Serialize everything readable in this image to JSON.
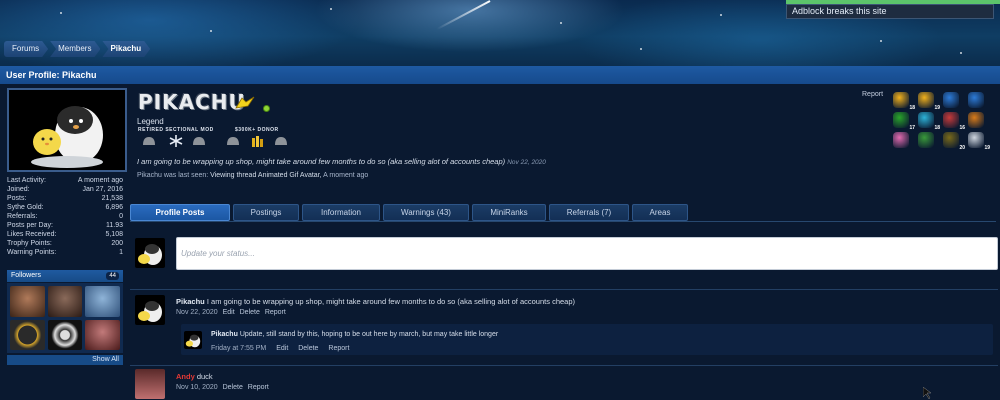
{
  "banner": {
    "adblock_notice": "Adblock breaks this site"
  },
  "breadcrumb": [
    "Forums",
    "Members",
    "Pikachu"
  ],
  "page_title": "User Profile: Pikachu",
  "profile": {
    "username": "PIKACHU",
    "user_title": "Legend",
    "rank_labels": [
      "RETIRED SECTIONAL MOD",
      "$300K+ DONOR"
    ],
    "status_message": "I am going to be wrapping up shop, might take around few months to do so (aka selling alot of accounts cheap)",
    "status_date": "Nov 22, 2020",
    "last_seen_prefix": "Pikachu was last seen:",
    "last_seen_activity": "Viewing thread Animated Gif Avatar,",
    "last_seen_time": "A moment ago",
    "report": "Report"
  },
  "stats": [
    {
      "label": "Last Activity:",
      "value": "A moment ago"
    },
    {
      "label": "Joined:",
      "value": "Jan 27, 2016"
    },
    {
      "label": "Posts:",
      "value": "21,538"
    },
    {
      "label": "Sythe Gold:",
      "value": "6,896"
    },
    {
      "label": "Referrals:",
      "value": "0"
    },
    {
      "label": "Posts per Day:",
      "value": "11.93"
    },
    {
      "label": "Likes Received:",
      "value": "5,108"
    },
    {
      "label": "Trophy Points:",
      "value": "200"
    },
    {
      "label": "Warning Points:",
      "value": "1"
    }
  ],
  "followers": {
    "title": "Followers",
    "count": "44",
    "show_all": "Show All"
  },
  "trophy_badges": [
    "18",
    "19",
    "",
    "",
    "17",
    "18",
    "16",
    "",
    "",
    "",
    "20",
    "19"
  ],
  "tabs": [
    {
      "label": "Profile Posts",
      "active": true
    },
    {
      "label": "Postings",
      "active": false
    },
    {
      "label": "Information",
      "active": false
    },
    {
      "label": "Warnings (43)",
      "active": false
    },
    {
      "label": "MiniRanks",
      "active": false
    },
    {
      "label": "Referrals (7)",
      "active": false
    },
    {
      "label": "Areas",
      "active": false
    }
  ],
  "status_input": {
    "placeholder": "Update your status..."
  },
  "posts": [
    {
      "author": "Pikachu",
      "text": "I am going to be wrapping up shop, might take around few months to do so (aka selling alot of accounts cheap)",
      "date": "Nov 22, 2020",
      "actions": [
        "Edit",
        "Delete",
        "Report"
      ],
      "comment": {
        "author": "Pikachu",
        "text": "Update, still stand by this, hoping to be out here by march, but may take little longer",
        "date": "Friday at 7:55 PM",
        "actions": [
          "Edit",
          "Delete",
          "Report"
        ]
      }
    },
    {
      "author": "Andy",
      "text": "duck",
      "date": "Nov 10, 2020",
      "actions": [
        "Delete",
        "Report"
      ]
    }
  ],
  "colors": {
    "accent": "#1e5aa3",
    "online": "#8fd636",
    "staff_name": "#e53935"
  }
}
